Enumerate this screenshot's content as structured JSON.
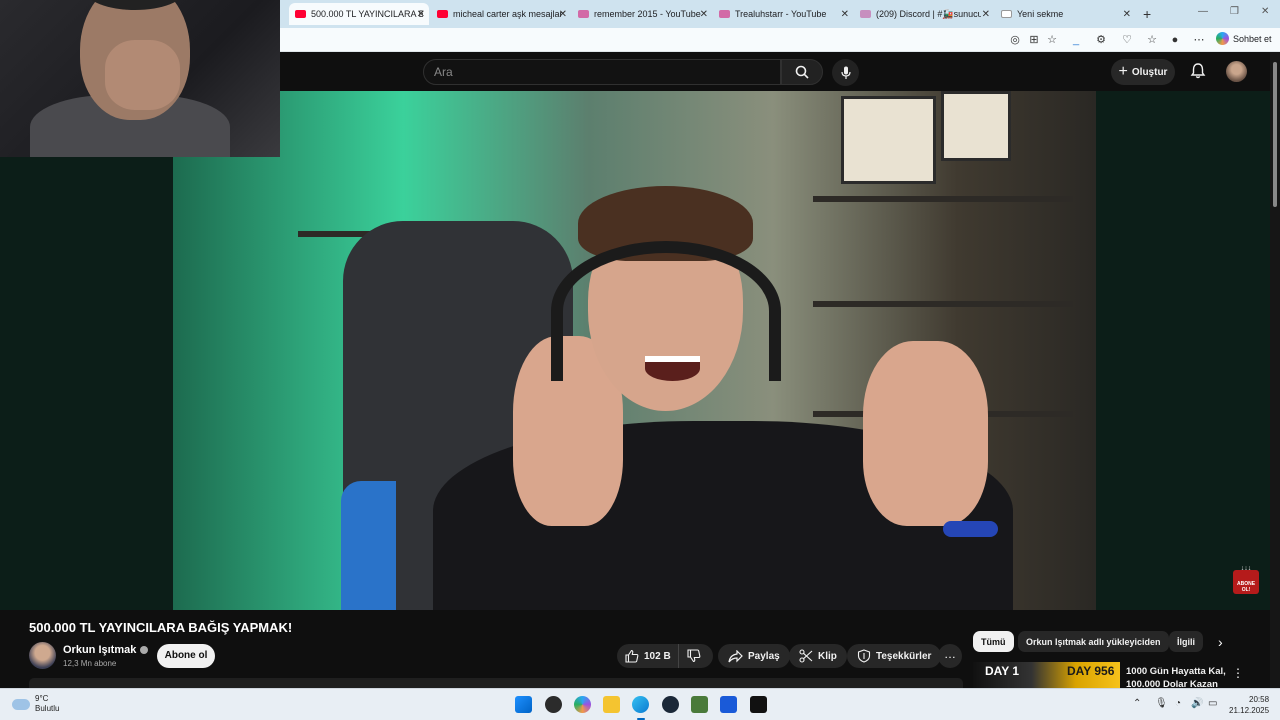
{
  "browser": {
    "tabs": [
      {
        "title": "500.000 TL YAYINCILARA BAĞ",
        "favicon": "youtube",
        "active": true
      },
      {
        "title": "micheal carter aşk mesajlar -",
        "favicon": "youtube",
        "active": false
      },
      {
        "title": "remember 2015 - YouTube",
        "favicon": "youtube-music",
        "active": false
      },
      {
        "title": "Trealuhstarr - YouTube",
        "favicon": "youtube-music",
        "active": false
      },
      {
        "title": "(209) Discord | #🚂sunucu-g",
        "favicon": "discord",
        "active": false
      },
      {
        "title": "Yeni sekme",
        "favicon": "edge-newtab",
        "active": false
      }
    ],
    "copilot_label": "Sohbet et"
  },
  "youtube": {
    "search_placeholder": "Ara",
    "create_label": "Oluştur",
    "video": {
      "title": "500.000 TL YAYINCILARA BAĞIŞ YAPMAK!",
      "subscribe_watermark": "ABONE OL!"
    },
    "channel": {
      "name": "Orkun Işıtmak",
      "subscribers": "12,3 Mn abone",
      "subscribe_label": "Abone ol"
    },
    "actions": {
      "likes": "102 B",
      "share": "Paylaş",
      "clip": "Klip",
      "thanks": "Teşekkürler",
      "more": "…"
    },
    "chips": [
      "Tümü",
      "Orkun Işıtmak adlı yükleyiciden",
      "İlgili"
    ],
    "recommendation": {
      "thumb_left": "DAY 1",
      "thumb_right": "DAY 956",
      "title": "1000 Gün Hayatta Kal, 100.000 Dolar Kazan"
    }
  },
  "taskbar": {
    "weather_temp": "9°C",
    "weather_desc": "Bulutlu",
    "time": "20:58",
    "date": "21.12.2025"
  },
  "colors": {
    "youtube_red": "#ff0033",
    "youtube_bg": "#0f0f0f",
    "tabstrip": "#cfe3ef",
    "taskbar": "#e8eef4"
  }
}
